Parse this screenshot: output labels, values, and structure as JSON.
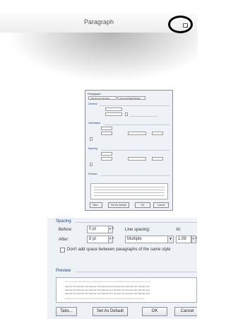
{
  "ribbon": {
    "group_label": "Paragraph"
  },
  "mini_dialog": {
    "title": "Paragraph",
    "tabs": [
      "Indents and Spacing",
      "Line and Page Breaks"
    ],
    "sections": [
      "General",
      "Indentation",
      "Spacing",
      "Preview"
    ],
    "buttons": [
      "Tabs...",
      "Set As Default",
      "OK",
      "Cancel"
    ]
  },
  "zoom": {
    "spacing_heading": "Spacing",
    "before_label": "Before:",
    "before_value": "0 pt",
    "after_label": "After:",
    "after_value": "8 pt",
    "line_spacing_label": "Line spacing:",
    "line_spacing_value": "Multiple",
    "at_label": "At:",
    "at_value": "1.08",
    "dont_add_label": "Don't add space between paragraphs of the same style",
    "preview_heading": "Preview",
    "preview_lines": [
      "Previous Paragraph Previous Paragraph Previous Paragraph Previous Paragraph Previous",
      "Sample Text Sample Text Sample Text Sample Text Sample Text Sample Text Sample Text",
      "Sample Text Sample Text Sample Text Sample Text Sample Text Sample Text Sample Text",
      "Sample Text Sample Text Sample Text Sample Text Sample Text Sample Text Sample Text",
      "Following Paragraph Following Paragraph Following Paragraph Following Paragraph"
    ],
    "buttons": {
      "tabs": "Tabs...",
      "set_default": "Set As Default",
      "ok": "OK",
      "cancel": "Cancel"
    }
  }
}
